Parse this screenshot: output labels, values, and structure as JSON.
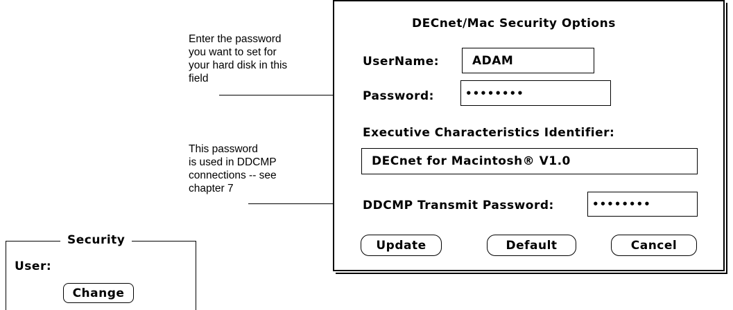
{
  "annotations": {
    "password_hint": "Enter the password\nyou want to set for\nyour hard disk in this\nfield",
    "ddcmp_hint": "This password\nis used in DDCMP\nconnections -- see\nchapter 7"
  },
  "dialog": {
    "title": "DECnet/Mac Security Options",
    "username_label": "UserName:",
    "username_value": "ADAM",
    "password_label": "Password:",
    "password_value": "••••••••",
    "eci_label": "Executive Characteristics Identifier:",
    "eci_value": "DECnet for Macintosh® V1.0",
    "ddcmp_label": "DDCMP Transmit Password:",
    "ddcmp_value": "••••••••",
    "buttons": {
      "update": "Update",
      "default": "Default",
      "cancel": "Cancel"
    }
  },
  "security_panel": {
    "title": "Security",
    "user_label": "User:",
    "change_button": "Change"
  }
}
